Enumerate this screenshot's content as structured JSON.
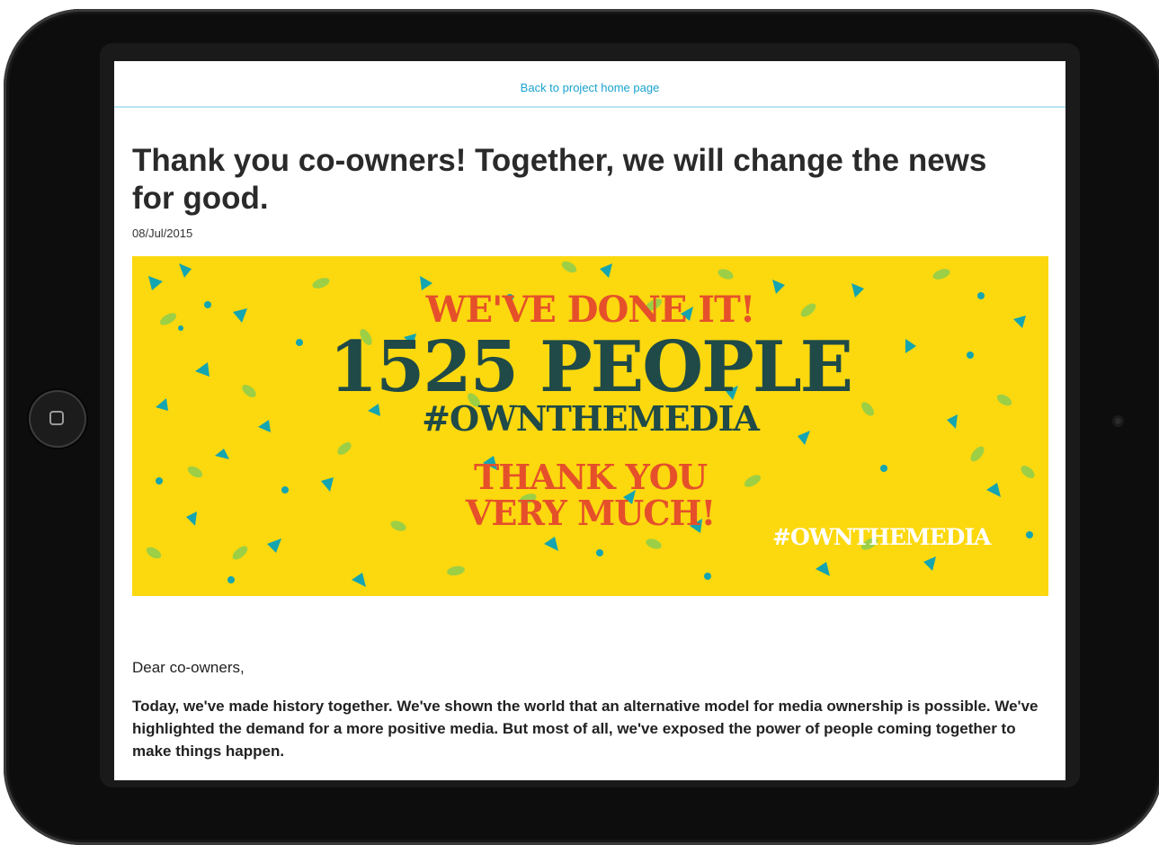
{
  "header": {
    "back_link": "Back to project home page"
  },
  "article": {
    "title": "Thank you co-owners! Together, we will change the news for good.",
    "date": "08/Jul/2015",
    "banner": {
      "line1": "WE'VE DONE IT!",
      "line2": "1525 PEOPLE",
      "line3": "#OWNTHEMEDIA",
      "line4": "THANK YOU",
      "line5": "VERY MUCH!",
      "corner_tag": "#OWNTHEMEDIA",
      "colors": {
        "background": "#fcd80f",
        "accent_red": "#e5502a",
        "dark_teal": "#1f4a48",
        "confetti_teal": "#14a5b0",
        "confetti_green": "#9ccf45"
      }
    },
    "greeting": "Dear co-owners,",
    "paragraph": "Today, we've made history together. We've shown the world that an alternative model for media ownership is possible. We've highlighted the demand for a more positive media. But most of all, we've exposed the power of people coming together to make things happen."
  },
  "device": {
    "home_button_icon": "home-square-icon",
    "camera_icon": "camera-dot-icon"
  },
  "colors": {
    "link": "#1aa3cf",
    "divider": "#b8e6f5",
    "text": "#2a2a2a"
  }
}
